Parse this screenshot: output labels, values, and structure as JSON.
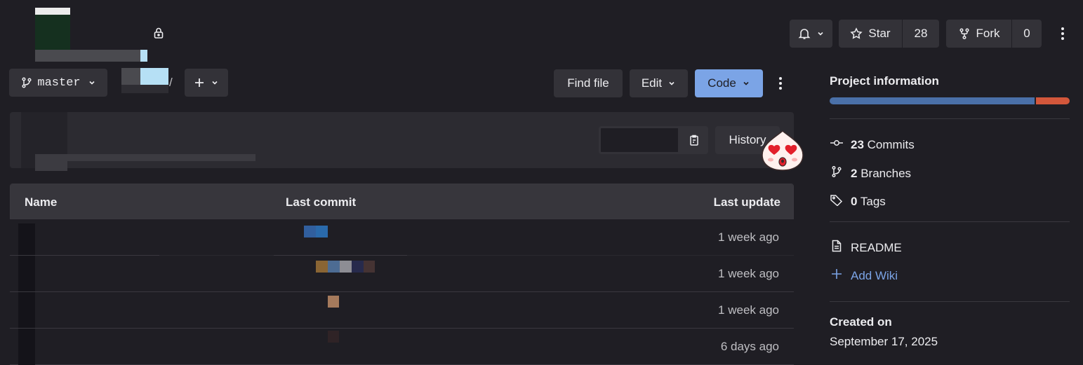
{
  "header": {
    "notifications_icon": "bell-icon",
    "star_label": "Star",
    "star_count": "28",
    "fork_label": "Fork",
    "fork_count": "0"
  },
  "toolbar": {
    "branch_name": "master",
    "path_separator": "/",
    "find_file_label": "Find file",
    "edit_label": "Edit",
    "code_label": "Code"
  },
  "commit_bar": {
    "history_label": "History"
  },
  "table": {
    "headers": {
      "name": "Name",
      "last_commit": "Last commit",
      "last_update": "Last update"
    },
    "rows": [
      {
        "last_update": "1 week ago"
      },
      {
        "last_update": "1 week ago"
      },
      {
        "last_update": "1 week ago"
      },
      {
        "last_update": "6 days ago"
      }
    ]
  },
  "sidebar": {
    "title": "Project information",
    "language_bar": [
      {
        "color": "#4a70a8",
        "fraction": 0.86
      },
      {
        "color": "#d3573b",
        "fraction": 0.14
      }
    ],
    "stats": [
      {
        "icon": "commit-icon",
        "count": "23",
        "label": "Commits"
      },
      {
        "icon": "branch-icon",
        "count": "2",
        "label": "Branches"
      },
      {
        "icon": "tag-icon",
        "count": "0",
        "label": "Tags"
      }
    ],
    "links": [
      {
        "icon": "document-icon",
        "label": "README"
      },
      {
        "icon": "plus-icon",
        "label": "Add Wiki"
      }
    ],
    "created_label": "Created on",
    "created_date": "September 17, 2025"
  },
  "colors": {
    "accent": "#7ba4e6",
    "background": "#1f1e24",
    "button": "#333238"
  }
}
